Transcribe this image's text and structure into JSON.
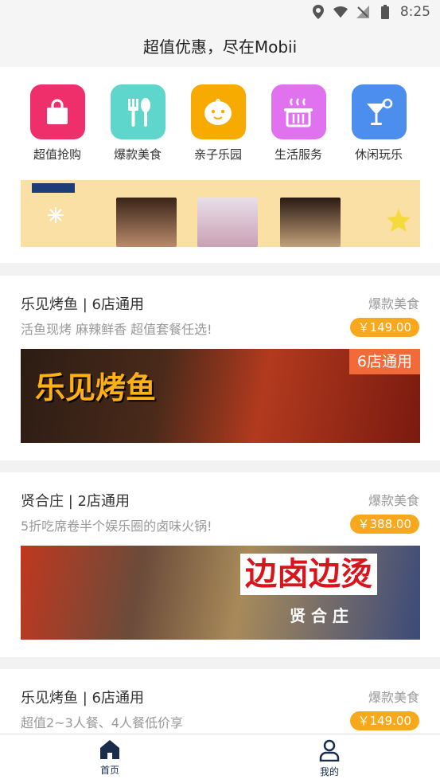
{
  "status": {
    "time": "8:25"
  },
  "header": {
    "title": "超值优惠，尽在Mobii"
  },
  "categories": [
    {
      "label": "超值抢购",
      "color": "#ee2f6c",
      "icon": "shopping-bag-icon"
    },
    {
      "label": "爆款美食",
      "color": "#5fd6cb",
      "icon": "fork-spoon-icon"
    },
    {
      "label": "亲子乐园",
      "color": "#f7aa00",
      "icon": "baby-face-icon"
    },
    {
      "label": "生活服务",
      "color": "#e071ef",
      "icon": "service-basket-icon"
    },
    {
      "label": "休闲玩乐",
      "color": "#4b8eed",
      "icon": "cocktail-icon"
    }
  ],
  "deals": [
    {
      "title": "乐见烤鱼 | 6店通用",
      "subtitle": "活鱼现烤 麻辣鲜香 超值套餐任选!",
      "category": "爆款美食",
      "price": "￥149.00",
      "image_text": "乐见烤鱼",
      "image_badge": "6店通用"
    },
    {
      "title": "贤合庄 | 2店通用",
      "subtitle": "5折吃席卷半个娱乐圈的卤味火锅!",
      "category": "爆款美食",
      "price": "￥388.00",
      "image_text": "边卤边烫",
      "image_badge": "贤 合 庄"
    },
    {
      "title": "乐见烤鱼 | 6店通用",
      "subtitle": "超值2~3人餐、4人餐低价享",
      "category": "爆款美食",
      "price": "￥149.00"
    }
  ],
  "nav": {
    "home": "首页",
    "mine": "我的"
  }
}
